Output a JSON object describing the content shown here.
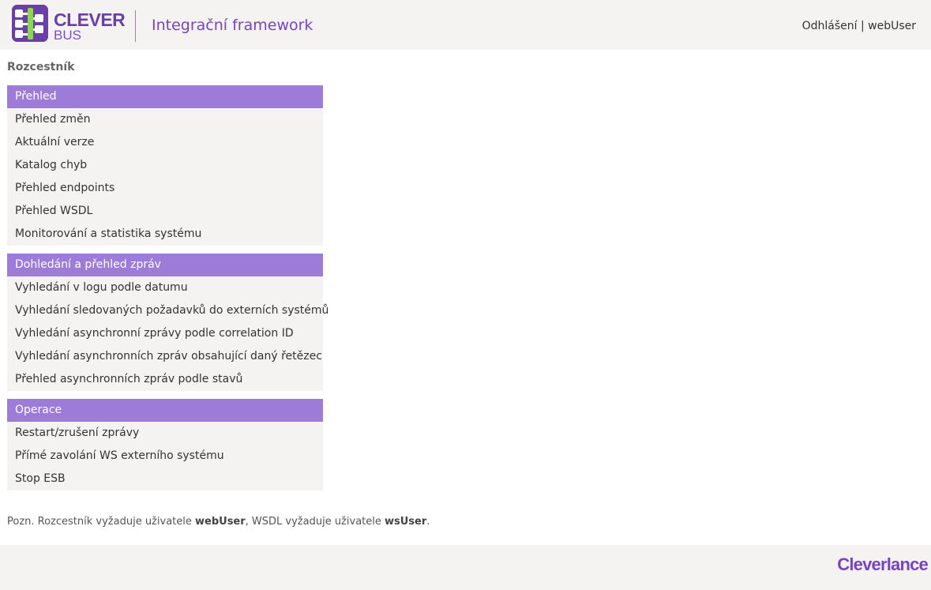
{
  "brand": {
    "name": "CLEVER",
    "sub": "BUS",
    "app_title": "Integrační framework"
  },
  "user_nav": {
    "logout": "Odhlášení",
    "separator": "|",
    "user": "webUser"
  },
  "page": {
    "title": "Rozcestník"
  },
  "menu": {
    "sections": [
      {
        "title": "Přehled",
        "items": [
          "Přehled změn",
          "Aktuální verze",
          "Katalog chyb",
          "Přehled endpoints",
          "Přehled WSDL",
          "Monitorování a statistika systému"
        ]
      },
      {
        "title": "Dohledání a přehled zpráv",
        "items": [
          "Vyhledání v logu podle datumu",
          "Vyhledání sledovaných požadavků do externích systémů",
          "Vyhledání asynchronní zprávy podle correlation ID",
          "Vyhledání asynchronních zpráv obsahující daný řetězec",
          "Přehled asynchronních zpráv podle stavů"
        ]
      },
      {
        "title": "Operace",
        "items": [
          "Restart/zrušení zprávy",
          "Přímé zavolání WS externího systému",
          "Stop ESB"
        ]
      }
    ]
  },
  "note": {
    "prefix": "Pozn. Rozcestník vyžaduje uživatele ",
    "user1": "webUser",
    "middle": ", WSDL vyžaduje uživatele ",
    "user2": "wsUser",
    "suffix": "."
  },
  "footer": {
    "logo": "Cleverlance"
  },
  "colors": {
    "accent": "#9d7cd7",
    "brand": "#6a3fa6",
    "bar": "#f4f3f1",
    "logo_green": "#8bd65a"
  },
  "icons": {
    "logo": "clever-bus-logo-icon"
  }
}
